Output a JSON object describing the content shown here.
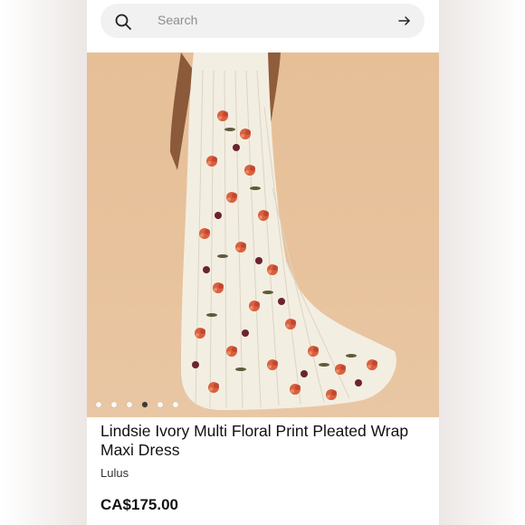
{
  "search": {
    "placeholder": "Search",
    "icon": "search-icon",
    "submit_icon": "arrow-right-icon"
  },
  "product": {
    "title": "Lindsie Ivory Multi Floral Print Pleated Wrap Maxi Dress",
    "brand": "Lulus",
    "price": "CA$175.00",
    "image_count": 6,
    "active_image_index": 3
  },
  "colors": {
    "background": "#ffffff",
    "photo_backdrop": "#e6bf97",
    "dress": "#f3eee2"
  }
}
